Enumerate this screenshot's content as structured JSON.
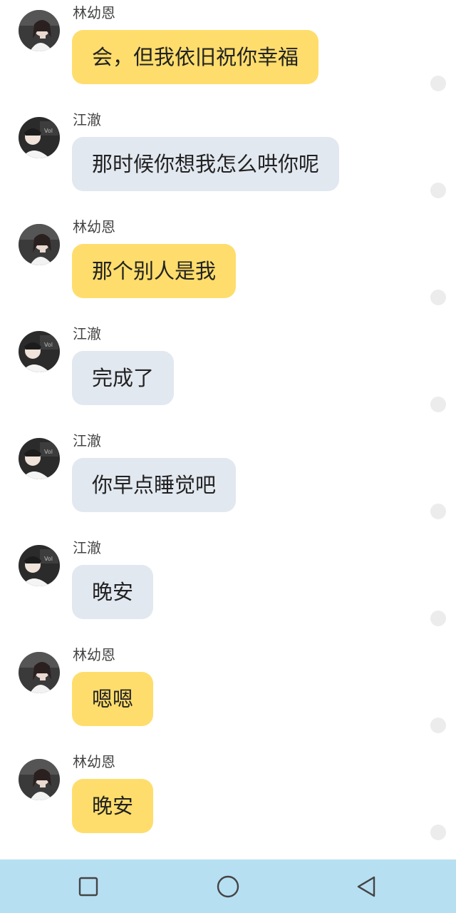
{
  "messages": [
    {
      "sender": "林幼恩",
      "text": "会，但我依旧祝你幸福",
      "side": "her"
    },
    {
      "sender": "江澈",
      "text": "那时候你想我怎么哄你呢",
      "side": "him"
    },
    {
      "sender": "林幼恩",
      "text": "那个别人是我",
      "side": "her"
    },
    {
      "sender": "江澈",
      "text": "完成了",
      "side": "him"
    },
    {
      "sender": "江澈",
      "text": "你早点睡觉吧",
      "side": "him"
    },
    {
      "sender": "江澈",
      "text": "晚安",
      "side": "him"
    },
    {
      "sender": "林幼恩",
      "text": "嗯嗯",
      "side": "her"
    },
    {
      "sender": "林幼恩",
      "text": "晚安",
      "side": "her"
    }
  ],
  "navbar": {
    "buttons": [
      "recent-apps",
      "home",
      "back"
    ]
  },
  "colors": {
    "her_bubble": "#fedd6c",
    "him_bubble": "#e2e8f0",
    "navbar": "#b7dff2"
  }
}
